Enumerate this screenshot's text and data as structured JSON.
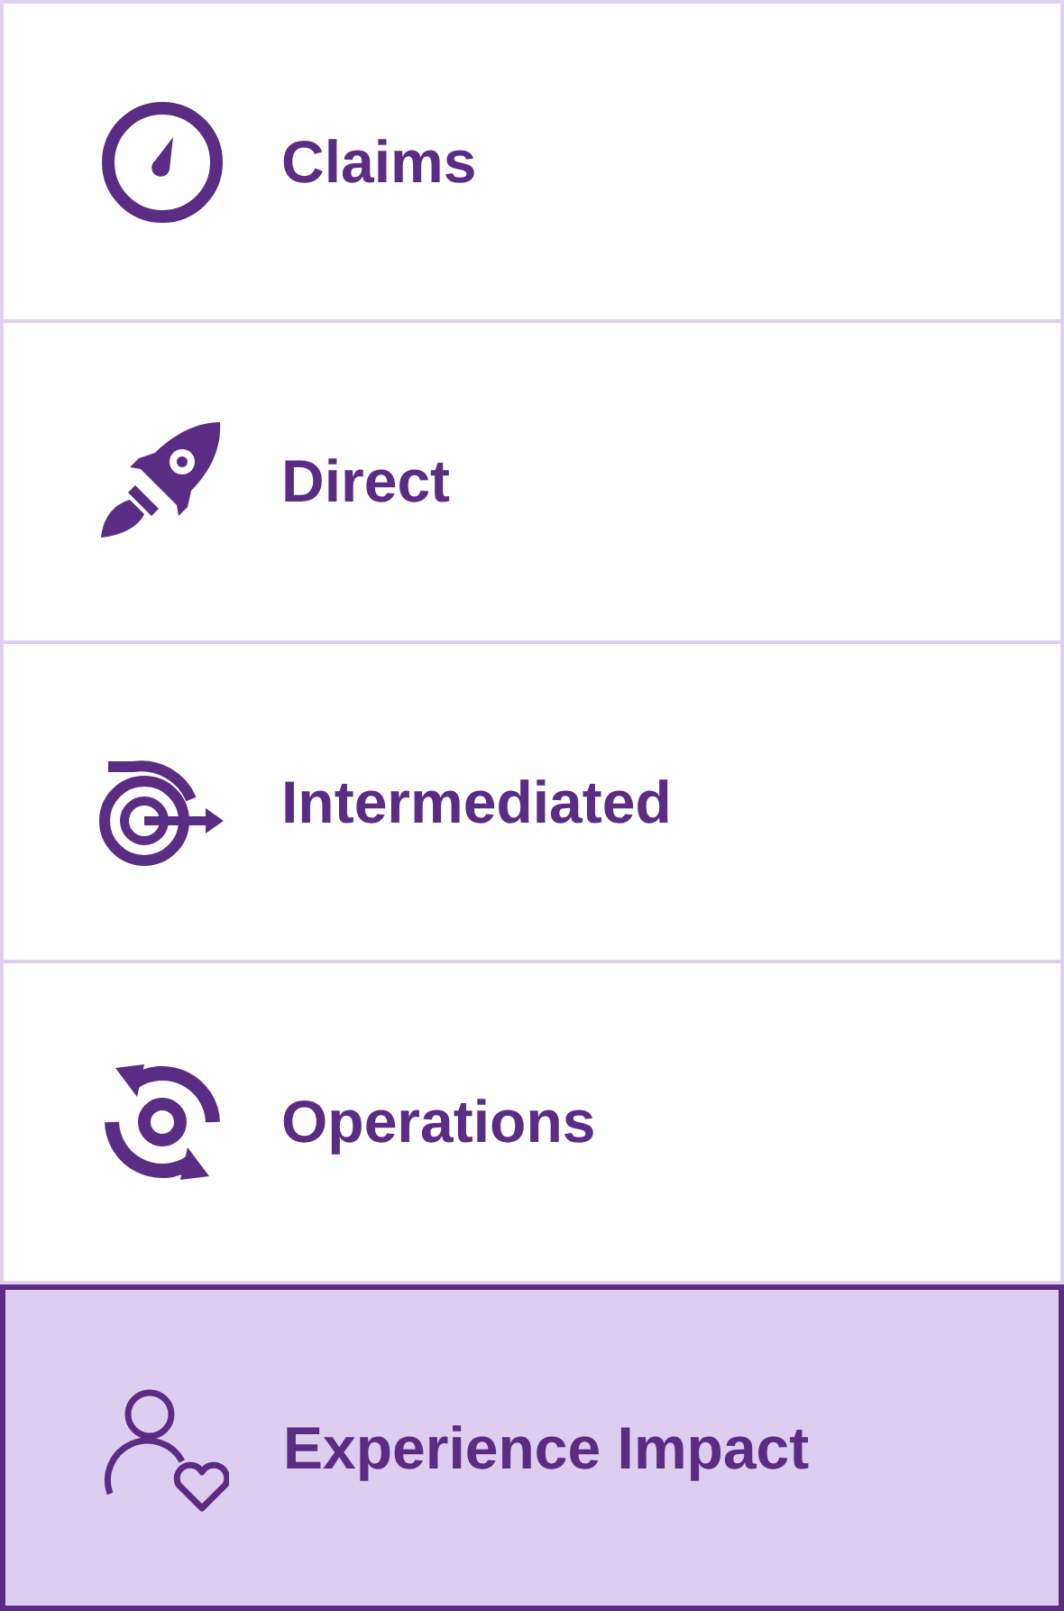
{
  "menu": {
    "items": [
      {
        "label": "Claims",
        "kind": "gauge",
        "selected": false
      },
      {
        "label": "Direct",
        "kind": "rocket",
        "selected": false
      },
      {
        "label": "Intermediated",
        "kind": "target",
        "selected": false
      },
      {
        "label": "Operations",
        "kind": "cycle",
        "selected": false
      },
      {
        "label": "Experience Impact",
        "kind": "person",
        "selected": true
      }
    ]
  }
}
